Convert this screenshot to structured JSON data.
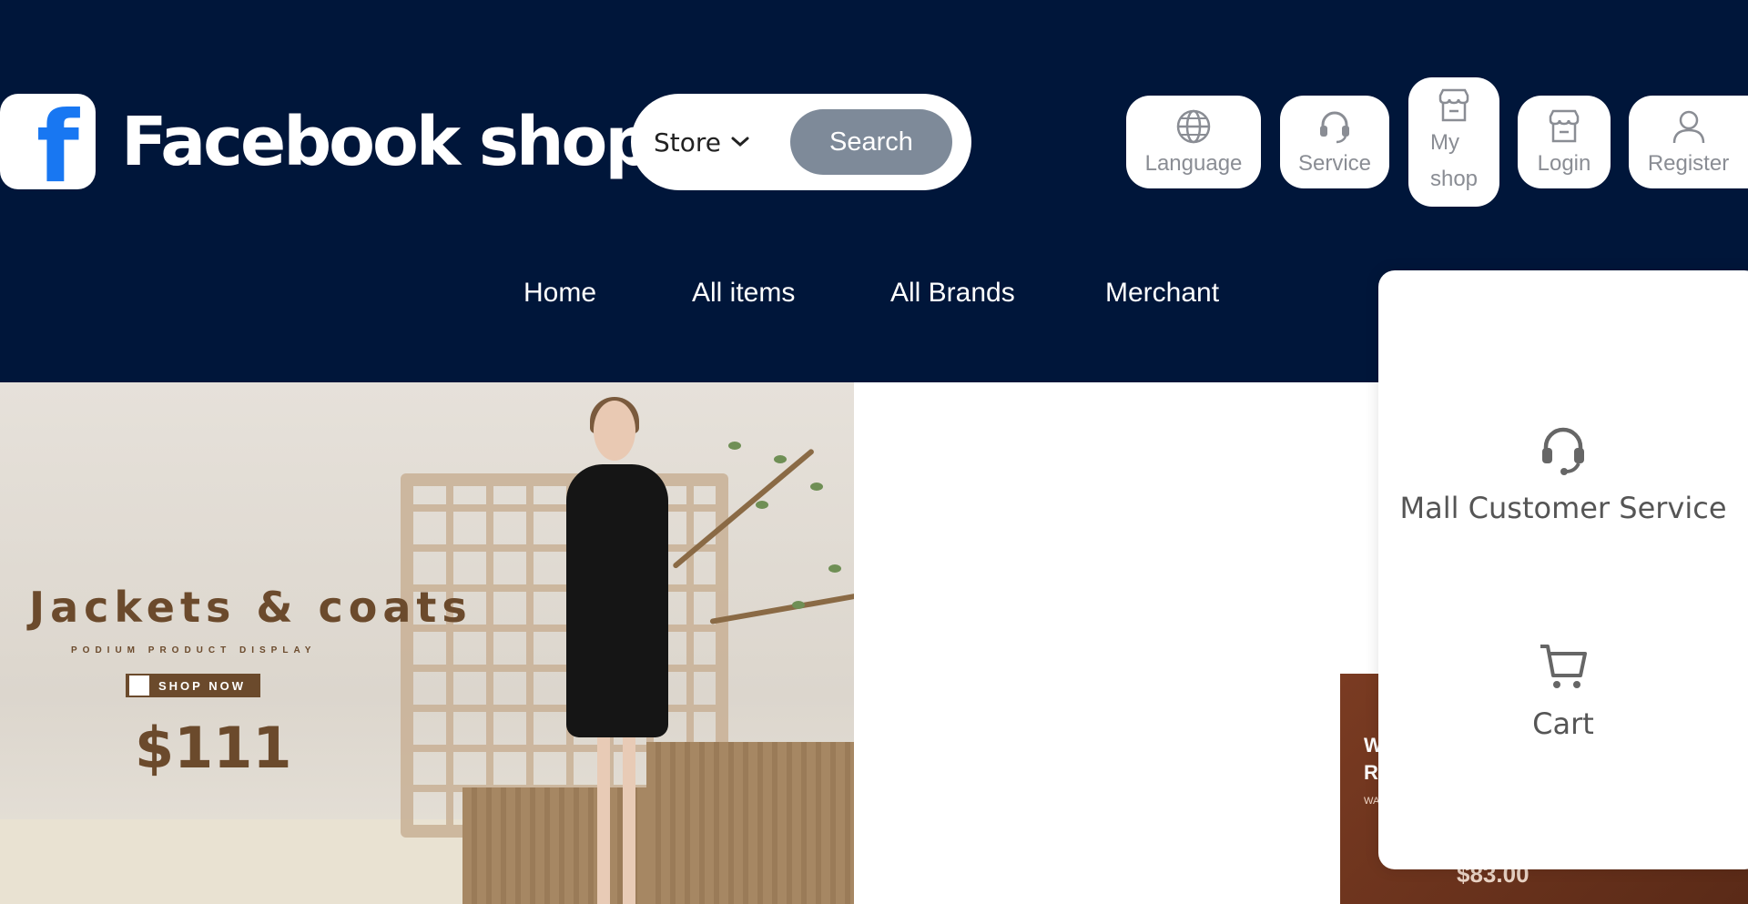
{
  "header": {
    "logo_letter": "f",
    "logo_text": "Facebook shop",
    "background": "#00163a"
  },
  "search": {
    "store_label": "Store",
    "button_label": "Search"
  },
  "toolbar": {
    "language": {
      "label": "Language",
      "icon": "globe-icon"
    },
    "service": {
      "label": "Service",
      "icon": "headset-icon"
    },
    "my_shop": {
      "line1": "My",
      "line2": "shop",
      "icon": "store-icon"
    },
    "login": {
      "label": "Login",
      "icon": "store-icon"
    },
    "register": {
      "label": "Register",
      "icon": "user-icon"
    }
  },
  "nav": {
    "items": [
      "Home",
      "All items",
      "All Brands",
      "Merchant"
    ]
  },
  "banner": {
    "title": "Jackets & coats",
    "subtitle": "PODIUM PRODUCT DISPLAY",
    "cta": "SHOP NOW",
    "price": "$111"
  },
  "promo": {
    "line1": "W",
    "line2": "R",
    "small": "WA",
    "price": "$83.00"
  },
  "service_menu": {
    "items": [
      {
        "label": "Mall Customer Service",
        "icon": "headset-icon"
      },
      {
        "label": "Cart",
        "icon": "cart-icon"
      }
    ]
  }
}
